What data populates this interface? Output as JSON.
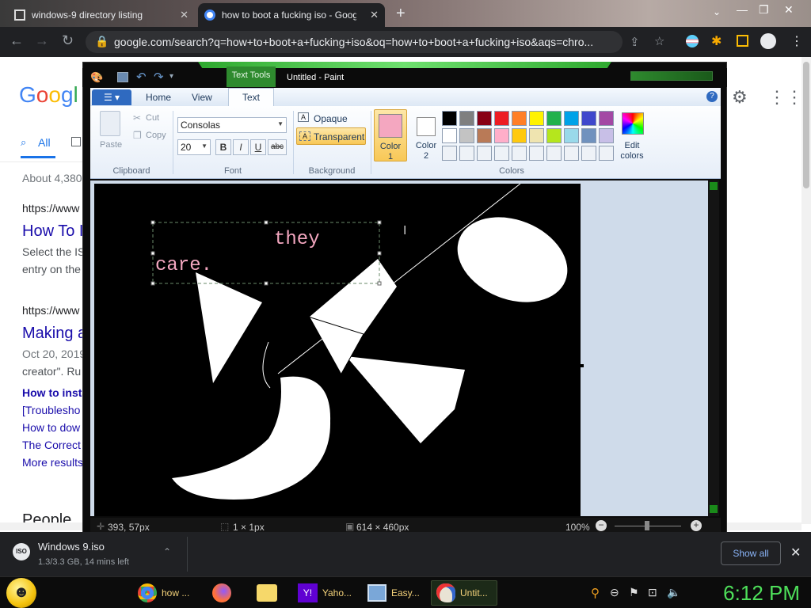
{
  "browser": {
    "tabs": [
      {
        "title": "windows-9 directory listing",
        "active": false
      },
      {
        "title": "how to boot a fucking iso - Goog",
        "active": true
      }
    ],
    "new_tab_icon": "plus-icon",
    "url": "google.com/search?q=how+to+boot+a+fucking+iso&oq=how+to+boot+a+fucking+iso&aqs=chro..."
  },
  "google": {
    "logo": "Googl",
    "tabs": [
      "All"
    ],
    "result_count": "About 4,380",
    "results": [
      {
        "url": "https://www",
        "title": "How To I",
        "snippet_1": "Select the IS",
        "snippet_2": "entry on the"
      },
      {
        "url": "https://www",
        "title": "Making a",
        "date": "Oct 20, 2019",
        "snippet_2": "creator\". Ru"
      }
    ],
    "links": [
      "How to insta",
      "[Troublesho",
      "How to dow",
      "The Correct",
      "More results"
    ],
    "people": "People"
  },
  "paint": {
    "context_tab": "Text Tools",
    "window_title": "Untitled - Paint",
    "ribbon_tabs": [
      "Home",
      "View",
      "Text"
    ],
    "active_tab": "Text",
    "clipboard": {
      "paste": "Paste",
      "cut": "Cut",
      "copy": "Copy",
      "group": "Clipboard"
    },
    "font": {
      "family": "Consolas",
      "size": "20",
      "group": "Font",
      "bold": "B",
      "italic": "I",
      "underline": "U",
      "strike": "abc"
    },
    "background": {
      "opaque": "Opaque",
      "transparent": "Transparent",
      "group": "Background"
    },
    "colors": {
      "color1_label": "Color 1",
      "color1_a": "Color",
      "color1_b": "1",
      "color2_a": "Color",
      "color2_b": "2",
      "color1": "#f4a7c0",
      "color2": "#ffffff",
      "edit_a": "Edit",
      "edit_b": "colors",
      "group": "Colors",
      "row1": [
        "#000000",
        "#7f7f7f",
        "#880015",
        "#ed1c24",
        "#ff7f27",
        "#fff200",
        "#22b14c",
        "#00a2e8",
        "#3f48cc",
        "#a349a4"
      ],
      "row2": [
        "#ffffff",
        "#c3c3c3",
        "#b97a57",
        "#ffaec9",
        "#ffc90e",
        "#efe4b0",
        "#b5e61d",
        "#99d9ea",
        "#7092be",
        "#c8bfe7"
      ]
    },
    "canvas_text_line1": "they",
    "canvas_text_line2": "care.",
    "status": {
      "cursor": "393, 57px",
      "selection": "1 × 1px",
      "size": "614 × 460px",
      "zoom": "100%"
    }
  },
  "download": {
    "name": "Windows 9.iso",
    "progress": "1.3/3.3 GB, 14 mins left",
    "show_all": "Show all"
  },
  "taskbar": {
    "items": [
      "how ...",
      "",
      "",
      "Yaho...",
      "Easy...",
      "Untit..."
    ],
    "clock": "6:12 PM"
  }
}
